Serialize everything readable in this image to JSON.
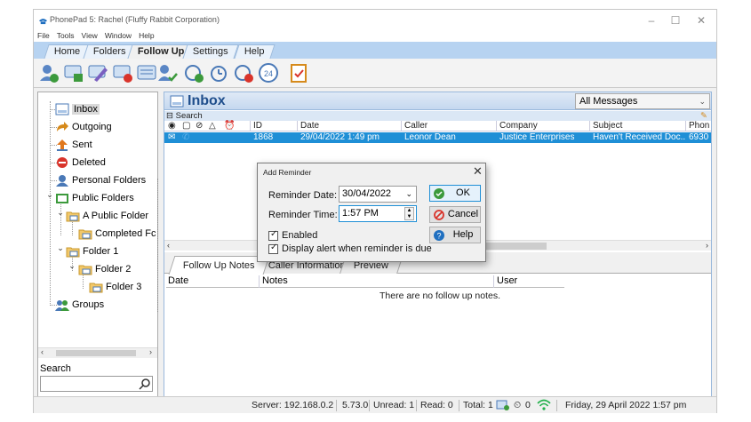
{
  "window": {
    "title": "PhonePad 5: Rachel  (Fluffy Rabbit Corporation)"
  },
  "menu": [
    "File",
    "Tools",
    "View",
    "Window",
    "Help"
  ],
  "ribbon_tabs": [
    "Home",
    "Folders",
    "Follow Up",
    "Settings",
    "Help"
  ],
  "ribbon_active_tab": "Follow Up",
  "ribbon_icons": [
    "add-followup-icon",
    "edit-followup-icon",
    "edit-followup2-icon",
    "delete-followup-icon",
    "note-icon",
    "assign-icon",
    "add-reminder-icon",
    "reminder-icon",
    "reminder-alert-icon",
    "24h-icon",
    "checklist-icon"
  ],
  "tree": {
    "items": [
      {
        "label": "Inbox"
      },
      {
        "label": "Outgoing"
      },
      {
        "label": "Sent"
      },
      {
        "label": "Deleted"
      },
      {
        "label": "Personal Folders"
      },
      {
        "label": "Public Folders"
      },
      {
        "label": "A Public Folder"
      },
      {
        "label": "Completed Fc"
      },
      {
        "label": "Folder 1"
      },
      {
        "label": "Folder 2"
      },
      {
        "label": "Folder 3"
      },
      {
        "label": "Groups"
      }
    ]
  },
  "search": {
    "label": "Search",
    "placeholder": ""
  },
  "inbox": {
    "title": "Inbox",
    "filter": "All Messages",
    "search_bar": "Search",
    "columns": [
      "ID",
      "Date",
      "Caller",
      "Company",
      "Subject",
      "Phon"
    ],
    "rows": [
      {
        "id": "1868",
        "date": "29/04/2022 1:49 pm",
        "caller": "Leonor Dean",
        "company": "Justice Enterprises",
        "subject": "Haven't Received Doc...",
        "phone": "6930"
      }
    ]
  },
  "lower_tabs": [
    "Follow Up Notes",
    "Caller Information",
    "Preview"
  ],
  "notes": {
    "columns": [
      "Date",
      "Notes",
      "User"
    ],
    "empty_text": "There are no follow up notes."
  },
  "dialog": {
    "title": "Add Reminder",
    "date_label": "Reminder Date:",
    "date_value": "30/04/2022",
    "time_label": "Reminder Time:",
    "time_value": "1:57 PM",
    "enabled_label": "Enabled",
    "alert_label": "Display alert when reminder is due",
    "ok": "OK",
    "cancel": "Cancel",
    "help": "Help"
  },
  "status": {
    "server": "Server: 192.168.0.2",
    "version": "5.73.0",
    "unread": "Unread: 1",
    "read": "Read: 0",
    "total": "Total: 1",
    "reminders": "0",
    "datetime": "Friday, 29 April 2022  1:57 pm"
  },
  "colors": {
    "accent": "#1f8fd6",
    "ribbon_tab_bar": "#b7d3f1",
    "title": "#1f4e8c"
  }
}
